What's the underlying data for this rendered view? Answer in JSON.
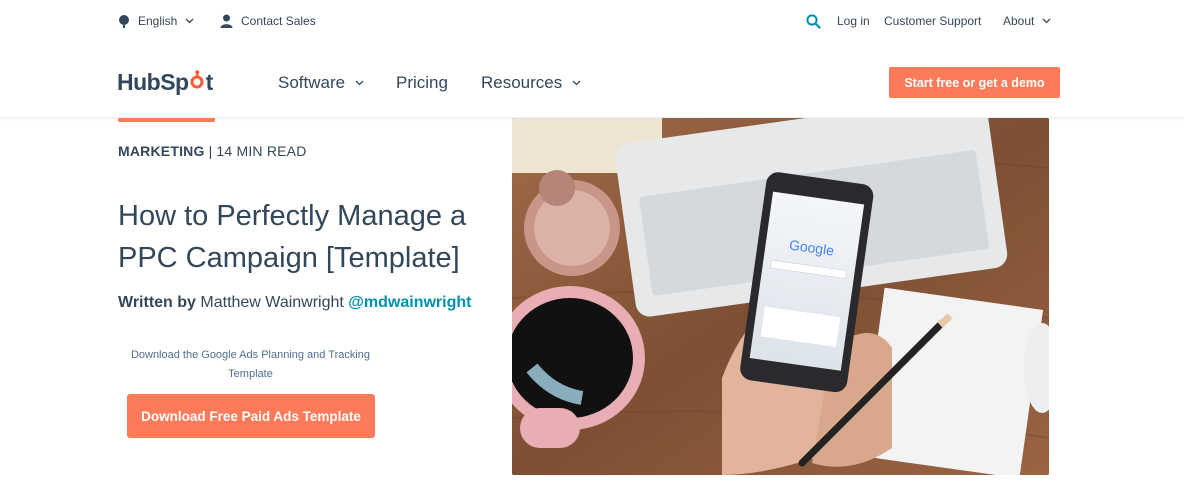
{
  "utility": {
    "language": "English",
    "contact": "Contact Sales",
    "login": "Log in",
    "support": "Customer Support",
    "about": "About"
  },
  "nav": {
    "logo_text_a": "HubSp",
    "logo_text_b": "t",
    "software": "Software",
    "pricing": "Pricing",
    "resources": "Resources",
    "cta": "Start free or get a demo"
  },
  "article": {
    "category": "MARKETING",
    "separator": "|",
    "read_time": "14 MIN READ",
    "title": "How to Perfectly Manage a PPC Campaign [Template]",
    "written_by": "Written by",
    "author": "Matthew Wainwright",
    "handle": "@mdwainwright",
    "promo_text": "Download the Google Ads Planning and Tracking Template",
    "download_button": "Download Free Paid Ads Template"
  },
  "hero": {
    "phone_brand": "Google"
  },
  "colors": {
    "accent": "#ff7a59",
    "text": "#33475b",
    "link": "#0091ae"
  }
}
